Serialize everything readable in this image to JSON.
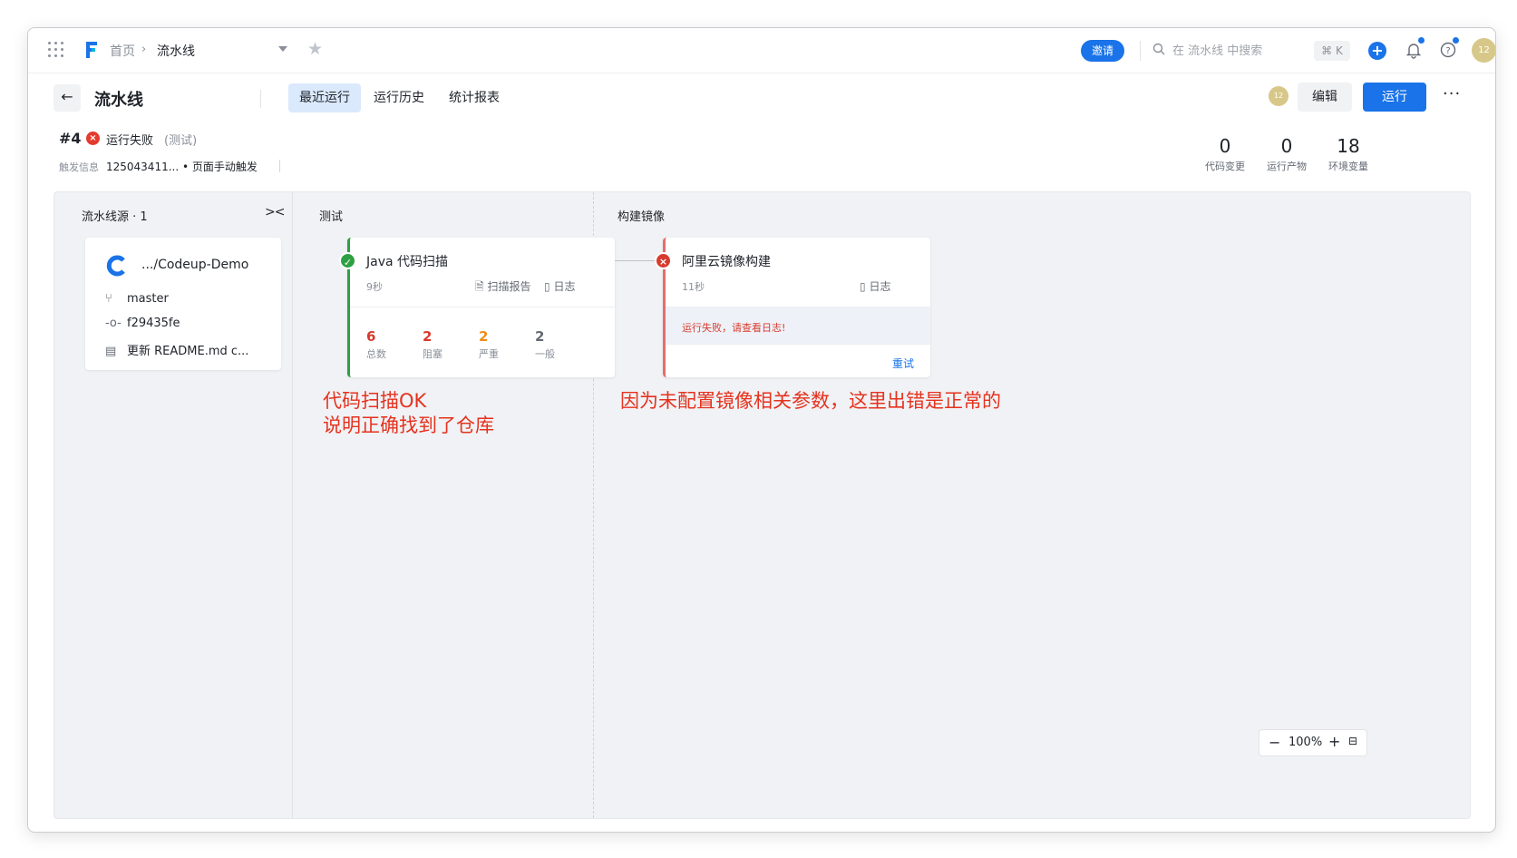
{
  "topbar": {
    "breadcrumb_home": "首页",
    "breadcrumb_sep": "›",
    "breadcrumb_current": "流水线",
    "invite_label": "邀请",
    "search_placeholder": "在 流水线 中搜索",
    "shortcut": "⌘ K",
    "avatar_text": "12"
  },
  "header": {
    "title": "流水线",
    "tabs": [
      {
        "label": "最近运行",
        "active": true
      },
      {
        "label": "运行历史",
        "active": false
      },
      {
        "label": "统计报表",
        "active": false
      }
    ],
    "avatar_text": "12",
    "edit_label": "编辑",
    "run_label": "运行",
    "more": "···"
  },
  "run": {
    "number": "#4",
    "status": "运行失败",
    "stage": "(测试)",
    "trigger_label": "触发信息",
    "trigger_value": "125043411... • 页面手动触发",
    "stats": [
      {
        "value": "0",
        "label": "代码变更"
      },
      {
        "value": "0",
        "label": "运行产物"
      },
      {
        "value": "18",
        "label": "环境变量"
      }
    ]
  },
  "canvas": {
    "source_header": "流水线源 · 1",
    "collapse_icon": "><",
    "source": {
      "repo": ".../Codeup-Demo",
      "branch": "master",
      "commit": "f29435fe",
      "message": "更新 README.md c..."
    },
    "stages": [
      {
        "name": "测试",
        "job": {
          "name": "Java 代码扫描",
          "status": "success",
          "duration": "9秒",
          "links": [
            "扫描报告",
            "日志"
          ],
          "metrics": [
            {
              "value": "6",
              "label": "总数",
              "color": "#d83b2e"
            },
            {
              "value": "2",
              "label": "阻塞",
              "color": "#d83b2e"
            },
            {
              "value": "2",
              "label": "严重",
              "color": "#f08c1a"
            },
            {
              "value": "2",
              "label": "一般",
              "color": "#646a73"
            }
          ]
        }
      },
      {
        "name": "构建镜像",
        "job": {
          "name": "阿里云镜像构建",
          "status": "failed",
          "duration": "11秒",
          "links": [
            "日志"
          ],
          "error": "运行失败，请查看日志!",
          "retry": "重试"
        }
      }
    ],
    "annotations": [
      {
        "line1": "代码扫描OK",
        "line2": "说明正确找到了仓库"
      },
      {
        "line1": "因为未配置镜像相关参数，这里出错是正常的"
      }
    ],
    "zoom": {
      "level": "100%"
    }
  },
  "colors": {
    "accent": "#1a73e8",
    "success": "#2ea043",
    "error": "#d83b2e",
    "annotation": "#e6321e"
  }
}
